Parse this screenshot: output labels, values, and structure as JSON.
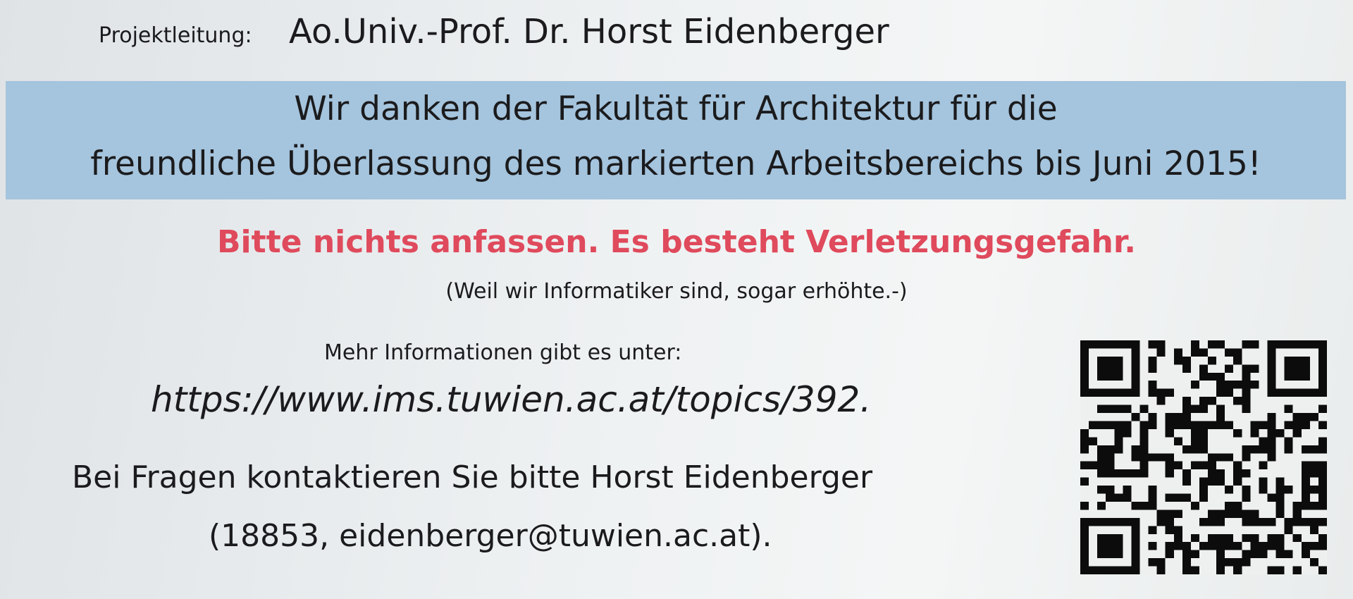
{
  "project_lead": {
    "label": "Projektleitung:",
    "name": "Ao.Univ.-Prof. Dr. Horst Eidenberger"
  },
  "thanks_banner": {
    "line1": "Wir danken der Fakultät für Architektur für die",
    "line2": "freundliche Überlassung des markierten Arbeitsbereichs bis Juni 2015!",
    "background_color": "#a5c4dd"
  },
  "warning": {
    "text": "Bitte nichts anfassen. Es besteht Verletzungsgefahr.",
    "color": "#df4a5c",
    "note": "(Weil wir Informatiker sind, sogar erhöhte.-)"
  },
  "more_info": {
    "label": "Mehr Informationen gibt es unter:",
    "url": "https://www.ims.tuwien.ac.at/topics/392."
  },
  "contact": {
    "line1": "Bei Fragen kontaktieren Sie bitte Horst Eidenberger",
    "line2": "(18853, eidenberger@tuwien.ac.at)."
  },
  "qr_code": {
    "icon": "qr-code-icon"
  }
}
